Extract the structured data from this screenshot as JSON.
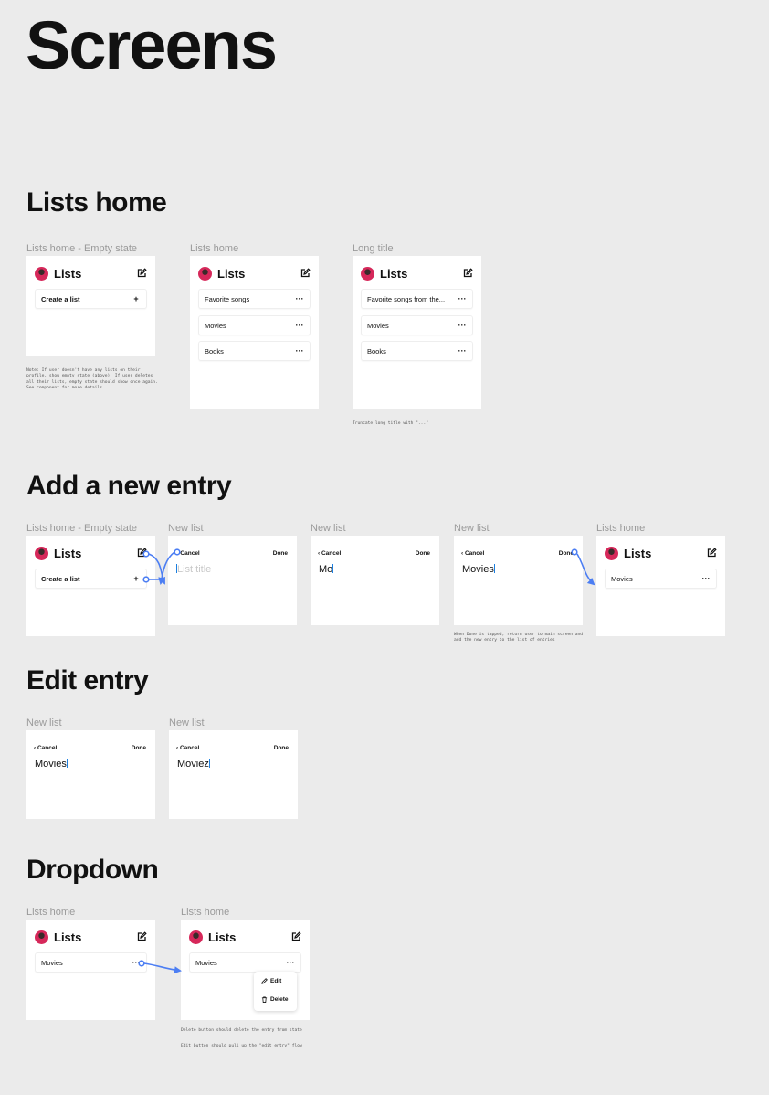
{
  "page_title": "Screens",
  "sections": {
    "lists_home": "Lists home",
    "add_entry": "Add a new entry",
    "edit_entry": "Edit entry",
    "dropdown": "Dropdown"
  },
  "labels": {
    "lists_home_empty": "Lists home - Empty state",
    "lists_home": "Lists home",
    "long_title": "Long title",
    "new_list": "New list"
  },
  "app": {
    "title": "Lists",
    "create_list": "Create a list",
    "more": "···",
    "plus": "+",
    "cancel": "Cancel",
    "done": "Done",
    "list_title_placeholder": "List title",
    "edit": "Edit",
    "delete": "Delete"
  },
  "items": {
    "favorite_songs": "Favorite songs",
    "favorite_songs_long": "Favorite songs from the...",
    "movies": "Movies",
    "books": "Books",
    "typed_partial": "Mo",
    "typed_edit": "Moviez"
  },
  "notes": {
    "empty_state": "Note: If user doesn't have any lists on their profile, show empty state (above). If user deletes all their lists, empty state should show once again. See component for more details.",
    "truncate": "Truncate long title with \"...\"",
    "done_return": "When Done is tapped, return user to main screen and add the new entry to the list of entries",
    "delete_note": "Delete button should delete the entry from state",
    "edit_note": "Edit button should pull up the \"edit entry\" flow"
  },
  "colors": {
    "background": "#ebebeb",
    "arrow": "#4c7ef3",
    "caret": "#1b7fe0",
    "avatar": "#d6285a"
  },
  "icons": [
    "edit-icon",
    "plus-icon",
    "more-icon",
    "chevron-left-icon",
    "pencil-icon",
    "trash-icon",
    "avatar"
  ]
}
